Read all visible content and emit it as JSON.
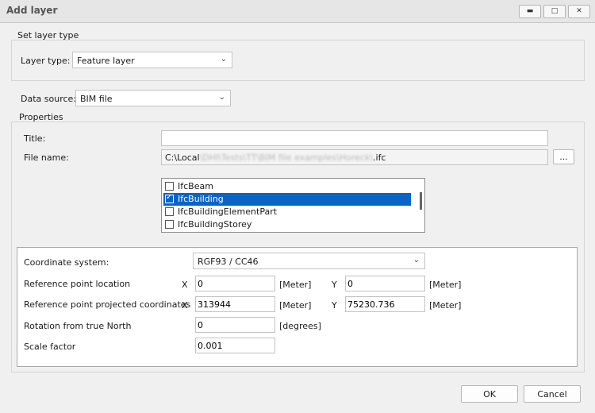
{
  "window": {
    "title": "Add layer"
  },
  "window_buttons": {
    "minimize": "▬",
    "maximize": "□",
    "close": "✕"
  },
  "layer_type_group": {
    "legend": "Set layer type",
    "label": "Layer type:",
    "value": "Feature layer"
  },
  "data_source": {
    "label": "Data source:",
    "value": "BIM file"
  },
  "properties": {
    "legend": "Properties",
    "title_label": "Title:",
    "title_value": "",
    "file_label": "File name:",
    "file_prefix": "C:\\Local",
    "file_hidden": "\\DHI\\Tests\\TT\\BIM file examples\\Horeck\\",
    "file_suffix": ".ifc",
    "browse_label": "..."
  },
  "ifc_list": [
    {
      "label": "IfcBeam",
      "checked": false,
      "selected": false
    },
    {
      "label": "IfcBuilding",
      "checked": true,
      "selected": true
    },
    {
      "label": "IfcBuildingElementPart",
      "checked": false,
      "selected": false
    },
    {
      "label": "IfcBuildingStorey",
      "checked": false,
      "selected": false
    }
  ],
  "coordinate": {
    "system_label": "Coordinate system:",
    "system_value": "RGF93 / CC46",
    "ref_loc_label": "Reference point location",
    "ref_proj_label": "Reference point projected coordinates",
    "rotation_label": "Rotation from true North",
    "scale_label": "Scale factor",
    "x_label": "X",
    "y_label": "Y",
    "ref_loc_x": "0",
    "ref_loc_y": "0",
    "ref_proj_x": "313944",
    "ref_proj_y": "75230.736",
    "rotation": "0",
    "scale": "0.001",
    "unit_meter": "[Meter]",
    "unit_degrees": "[degrees]"
  },
  "footer": {
    "ok": "OK",
    "cancel": "Cancel"
  },
  "icons": {
    "chevron": "⌄",
    "check": "✓"
  }
}
